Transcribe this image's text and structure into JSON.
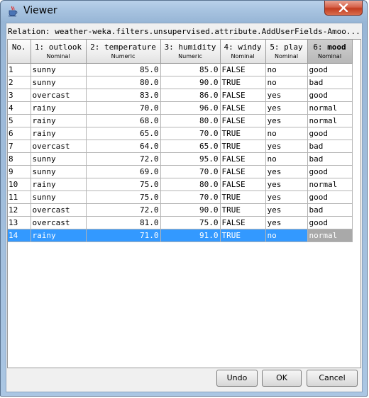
{
  "window": {
    "title": "Viewer"
  },
  "relation": "Relation: weather-weka.filters.unsupervised.attribute.AddUserFields-Amoo...",
  "table": {
    "columns": [
      {
        "name": "No.",
        "type": ""
      },
      {
        "name": "1: outlook",
        "type": "Nominal"
      },
      {
        "name": "2: temperature",
        "type": "Numeric"
      },
      {
        "name": "3: humidity",
        "type": "Numeric"
      },
      {
        "name": "4: windy",
        "type": "Nominal"
      },
      {
        "name": "5: play",
        "type": "Nominal"
      },
      {
        "name": "6: mood",
        "type": "Nominal"
      }
    ],
    "rows": [
      [
        "1",
        "sunny",
        "85.0",
        "85.0",
        "FALSE",
        "no",
        "good"
      ],
      [
        "2",
        "sunny",
        "80.0",
        "90.0",
        "TRUE",
        "no",
        "bad"
      ],
      [
        "3",
        "overcast",
        "83.0",
        "86.0",
        "FALSE",
        "yes",
        "good"
      ],
      [
        "4",
        "rainy",
        "70.0",
        "96.0",
        "FALSE",
        "yes",
        "normal"
      ],
      [
        "5",
        "rainy",
        "68.0",
        "80.0",
        "FALSE",
        "yes",
        "normal"
      ],
      [
        "6",
        "rainy",
        "65.0",
        "70.0",
        "TRUE",
        "no",
        "good"
      ],
      [
        "7",
        "overcast",
        "64.0",
        "65.0",
        "TRUE",
        "yes",
        "bad"
      ],
      [
        "8",
        "sunny",
        "72.0",
        "95.0",
        "FALSE",
        "no",
        "bad"
      ],
      [
        "9",
        "sunny",
        "69.0",
        "70.0",
        "FALSE",
        "yes",
        "good"
      ],
      [
        "10",
        "rainy",
        "75.0",
        "80.0",
        "FALSE",
        "yes",
        "normal"
      ],
      [
        "11",
        "sunny",
        "75.0",
        "70.0",
        "TRUE",
        "yes",
        "good"
      ],
      [
        "12",
        "overcast",
        "72.0",
        "90.0",
        "TRUE",
        "yes",
        "bad"
      ],
      [
        "13",
        "overcast",
        "81.0",
        "75.0",
        "FALSE",
        "yes",
        "good"
      ],
      [
        "14",
        "rainy",
        "71.0",
        "91.0",
        "TRUE",
        "no",
        "normal"
      ]
    ],
    "selected_row": 14,
    "selected_column": "6: mood"
  },
  "buttons": {
    "undo": "Undo",
    "ok": "OK",
    "cancel": "Cancel"
  },
  "icons": {
    "app": "java-cup-icon",
    "close": "close-icon"
  },
  "colors": {
    "selection": "#3399ff",
    "close_button": "#c23c20"
  }
}
